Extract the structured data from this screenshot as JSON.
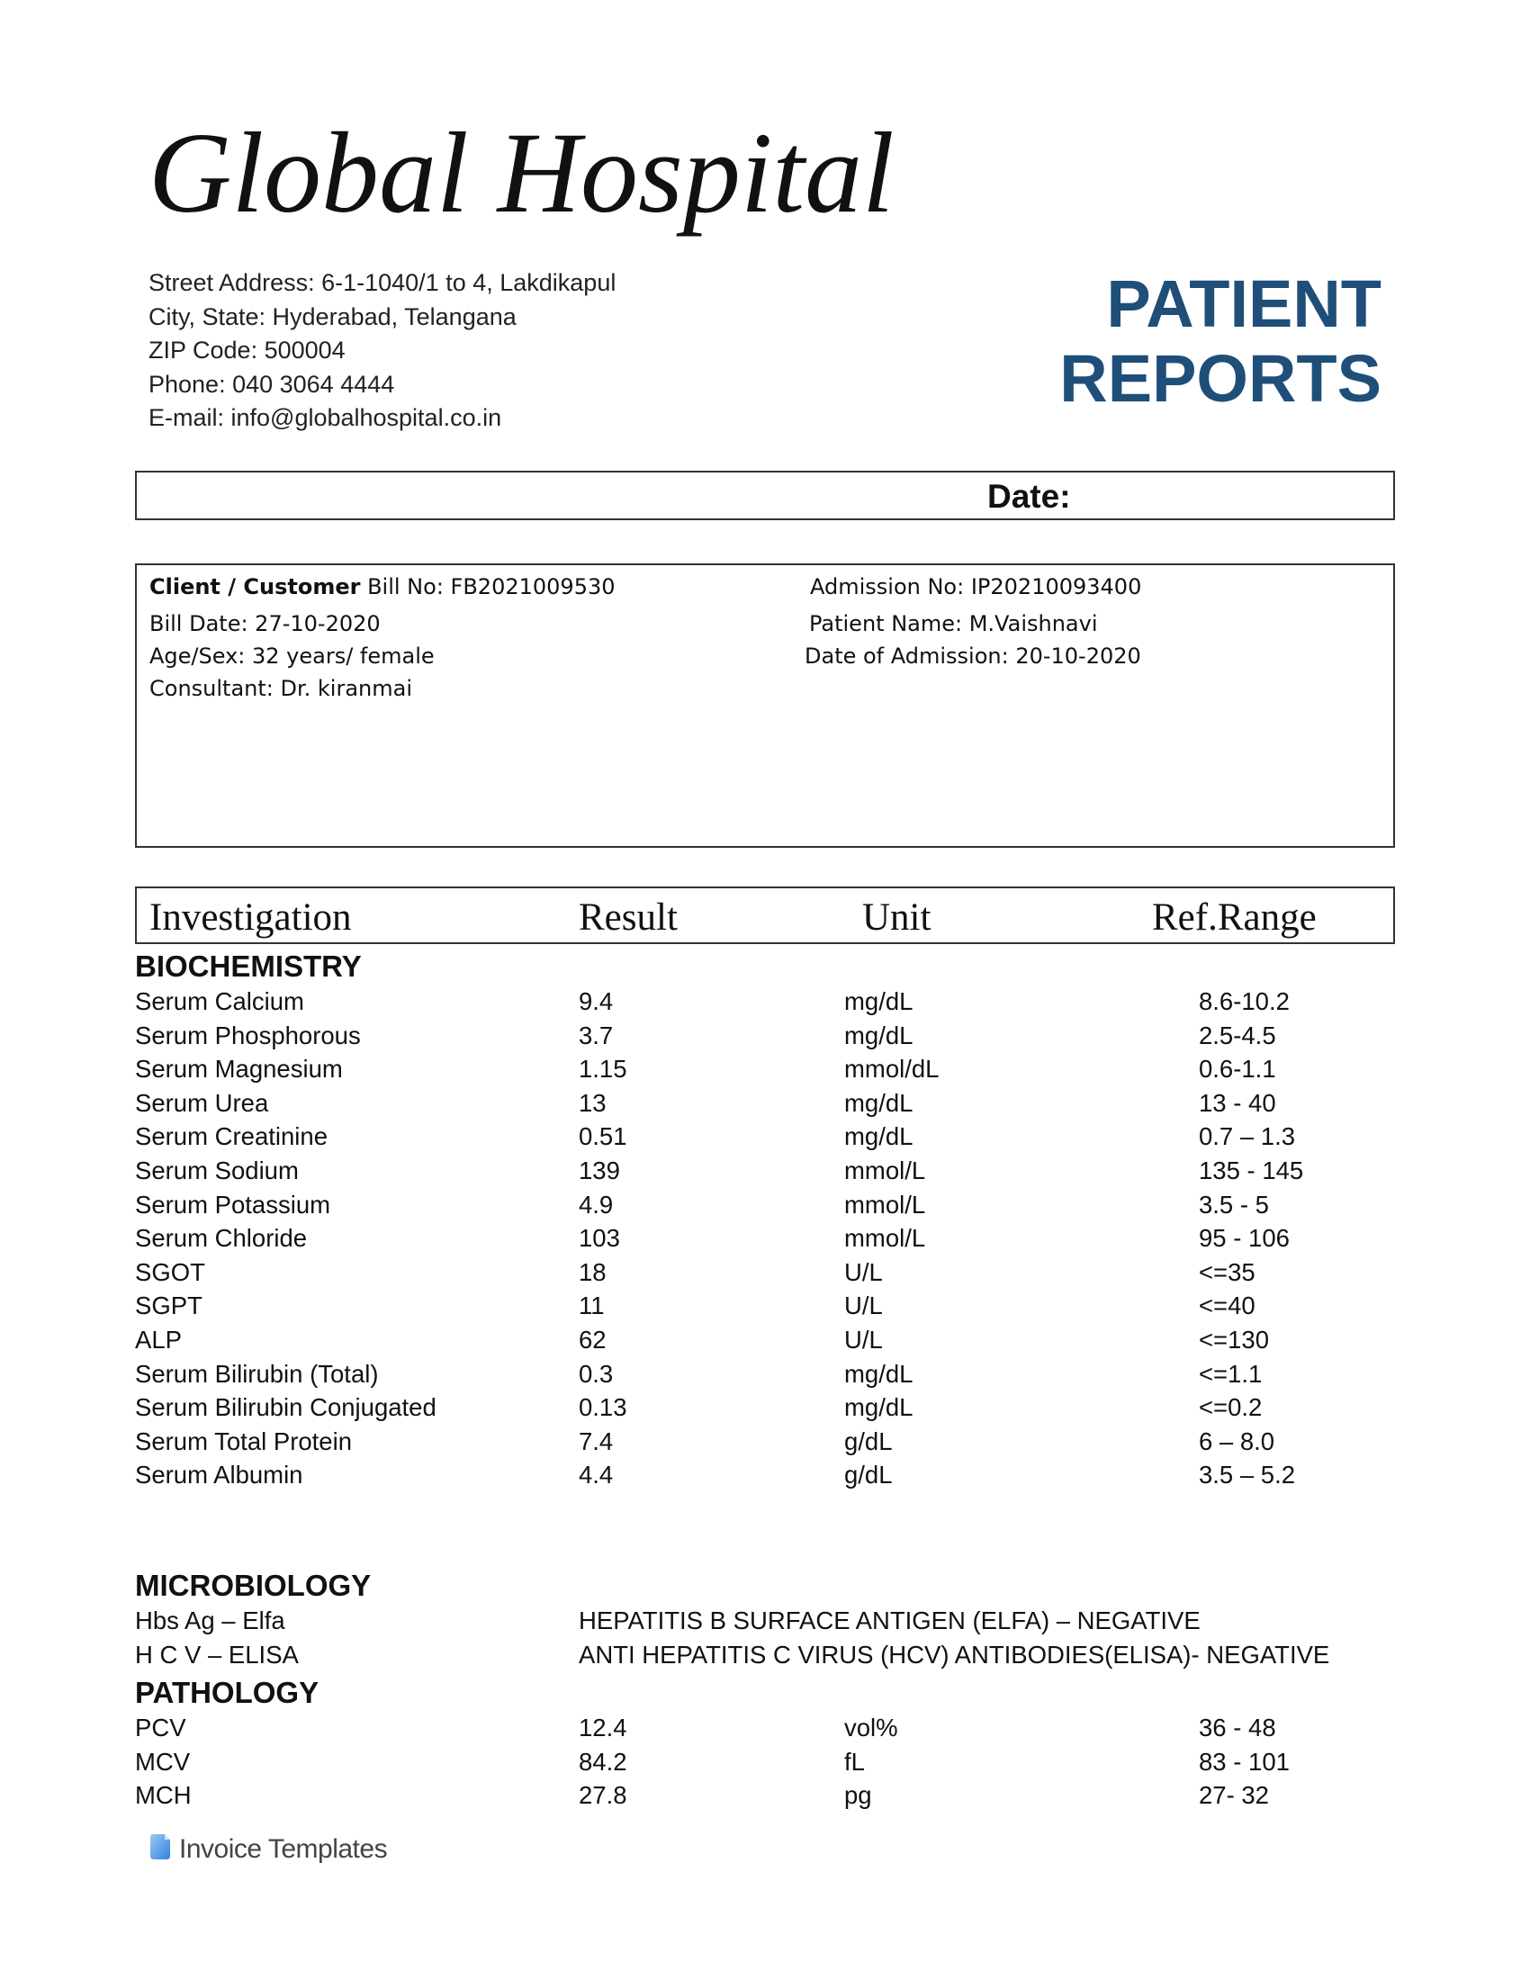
{
  "header": {
    "hospital_name": "Global Hospital",
    "address_lines": [
      "Street Address: 6-1-1040/1 to 4, Lakdikapul",
      "City, State: Hyderabad, Telangana",
      "ZIP Code: 500004",
      "Phone: 040 3064 4444",
      "E-mail: info@globalhospital.co.in"
    ],
    "report_title_line1": "PATIENT",
    "report_title_line2": "REPORTS"
  },
  "date_label": "Date:",
  "patient": {
    "client_bold": "Client / Customer",
    "bill_no": " Bill No: FB2021009530",
    "bill_date": "Bill Date: 27-10-2020",
    "age_sex": "Age/Sex: 32 years/ female",
    "consultant": "Consultant: Dr. kiranmai",
    "admission_no": "Admission No: IP20210093400",
    "patient_name": "Patient Name: M.Vaishnavi",
    "date_of_admission": "Date of Admission: 20-10-2020"
  },
  "table_headers": [
    "Investigation",
    "Result",
    "Unit",
    "Ref.Range"
  ],
  "sections": {
    "biochemistry": {
      "title": "BIOCHEMISTRY",
      "rows": [
        [
          "Serum Calcium",
          "9.4",
          "mg/dL",
          "8.6-10.2"
        ],
        [
          "Serum Phosphorous",
          "3.7",
          "mg/dL",
          "2.5-4.5"
        ],
        [
          "Serum Magnesium",
          "1.15",
          "mmol/dL",
          "0.6-1.1"
        ],
        [
          "Serum Urea",
          "13",
          "mg/dL",
          "13 - 40"
        ],
        [
          "Serum Creatinine",
          "0.51",
          "mg/dL",
          "0.7 – 1.3"
        ],
        [
          "Serum Sodium",
          "139",
          "mmol/L",
          "135 - 145"
        ],
        [
          "Serum Potassium",
          "4.9",
          "mmol/L",
          "3.5 - 5"
        ],
        [
          "Serum Chloride",
          "103",
          "mmol/L",
          "95 - 106"
        ],
        [
          "SGOT",
          "18",
          "U/L",
          "<=35"
        ],
        [
          "SGPT",
          "11",
          "U/L",
          "<=40"
        ],
        [
          "ALP",
          "62",
          "U/L",
          "<=130"
        ],
        [
          "Serum Bilirubin (Total)",
          "0.3",
          "mg/dL",
          "<=1.1"
        ],
        [
          "Serum Bilirubin Conjugated",
          "0.13",
          "mg/dL",
          "<=0.2"
        ],
        [
          "Serum Total Protein",
          "7.4",
          "g/dL",
          "6 – 8.0"
        ],
        [
          "Serum Albumin",
          "4.4",
          "g/dL",
          "3.5 – 5.2"
        ]
      ]
    },
    "microbiology": {
      "title": "MICROBIOLOGY",
      "rows": [
        [
          "Hbs Ag – Elfa",
          "HEPATITIS B SURFACE ANTIGEN (ELFA) – NEGATIVE"
        ],
        [
          "H C V – ELISA",
          "ANTI HEPATITIS C VIRUS (HCV) ANTIBODIES(ELISA)- NEGATIVE"
        ]
      ]
    },
    "pathology": {
      "title": "PATHOLOGY",
      "rows": [
        [
          "PCV",
          "12.4",
          "vol%",
          "36 - 48"
        ],
        [
          "MCV",
          "84.2",
          "fL",
          "83 - 101"
        ],
        [
          "MCH",
          "27.8",
          "pg",
          "27- 32"
        ]
      ]
    }
  },
  "footer": {
    "logo_text": "Invoice Templates",
    "logo_icon": "invoice-templates-logo-icon",
    "accent": "#1f4e79"
  }
}
